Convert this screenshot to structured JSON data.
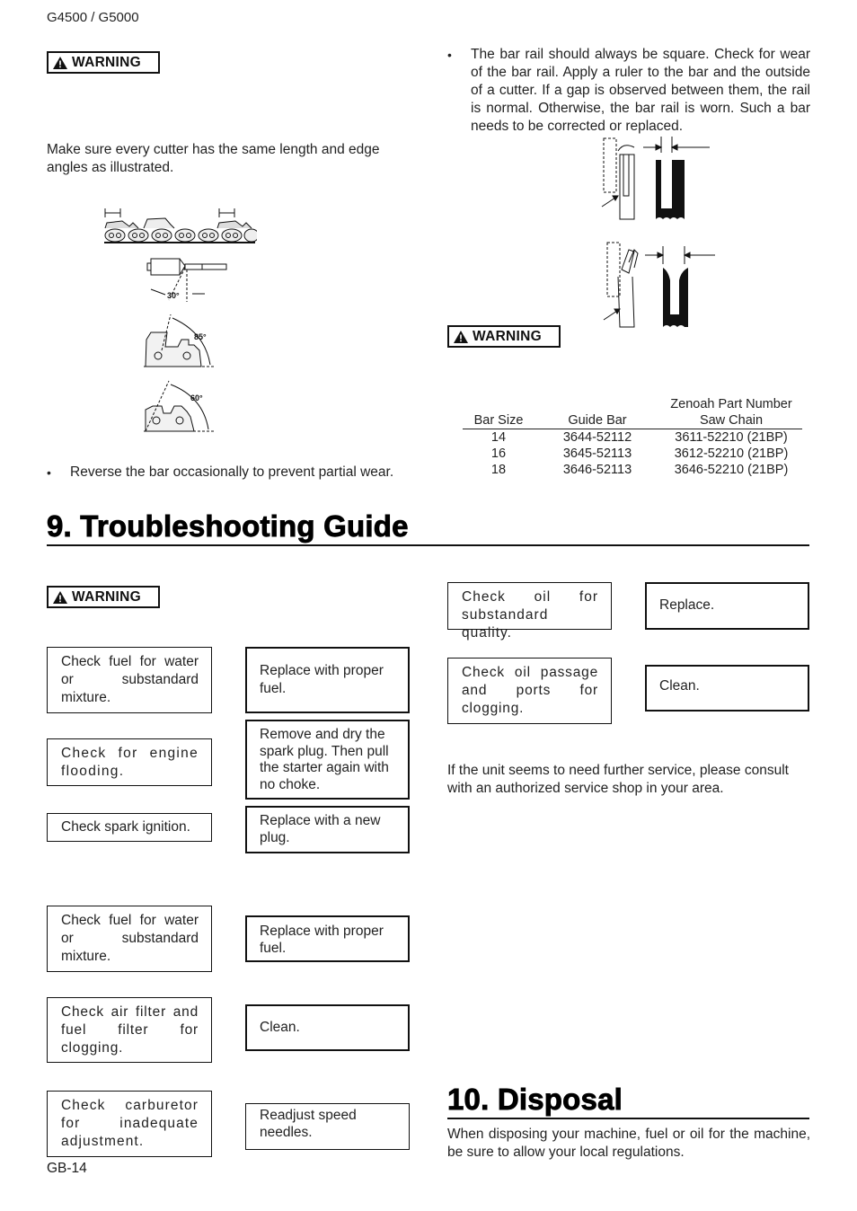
{
  "header": {
    "model": "G4500 / G5000"
  },
  "warning_label": "WARNING",
  "left_top": {
    "cutter_note": "Make sure every cutter has the same length and edge angles as illustrated.",
    "angle_labels": [
      "30°",
      "85°",
      "60°"
    ],
    "reverse_bar_note": "Reverse the bar occasionally to prevent partial wear."
  },
  "right_top": {
    "bar_rail_note": "The bar rail should always be square. Check for wear of the bar rail. Apply a ruler to the bar and the outside of a cutter. If a gap is observed between them, the rail is normal. Otherwise, the bar rail is worn. Such a bar needs to be corrected or replaced.",
    "parts_table": {
      "group_header": "Zenoah Part Number",
      "columns": [
        "Bar Size",
        "Guide Bar",
        "Saw Chain"
      ],
      "rows": [
        [
          "14",
          "3644-52112",
          "3611-52210 (21BP)"
        ],
        [
          "16",
          "3645-52113",
          "3612-52210 (21BP)"
        ],
        [
          "18",
          "3646-52113",
          "3646-52210 (21BP)"
        ]
      ]
    }
  },
  "troubleshooting": {
    "title": "9. Troubleshooting Guide",
    "group1": [
      {
        "check": "Check fuel for water or substandard mixture.",
        "remedy": "Replace with proper fuel."
      },
      {
        "check": "Check for engine flooding.",
        "remedy": "Remove and dry the spark plug. Then pull the starter again with no choke."
      },
      {
        "check": "Check spark ignition.",
        "remedy": "Replace with a new plug."
      }
    ],
    "group2": [
      {
        "check": "Check fuel for water or substandard mixture.",
        "remedy": "Replace with proper fuel."
      },
      {
        "check": "Check air filter and fuel filter for clogging.",
        "remedy": "Clean."
      },
      {
        "check": "Check carburetor for inadequate adjustment.",
        "remedy": "Readjust speed needles."
      }
    ],
    "group3": [
      {
        "check": "Check oil for substandard quality.",
        "remedy": "Replace."
      },
      {
        "check": "Check oil passage and ports for clogging.",
        "remedy": "Clean."
      }
    ],
    "service_note": "If the unit seems to need further service, please consult with an authorized service shop in your area."
  },
  "disposal": {
    "title": "10. Disposal",
    "text": "When disposing your machine, fuel or oil for the machine, be sure to allow your local regulations."
  },
  "footer": {
    "page_number": "GB-14"
  }
}
